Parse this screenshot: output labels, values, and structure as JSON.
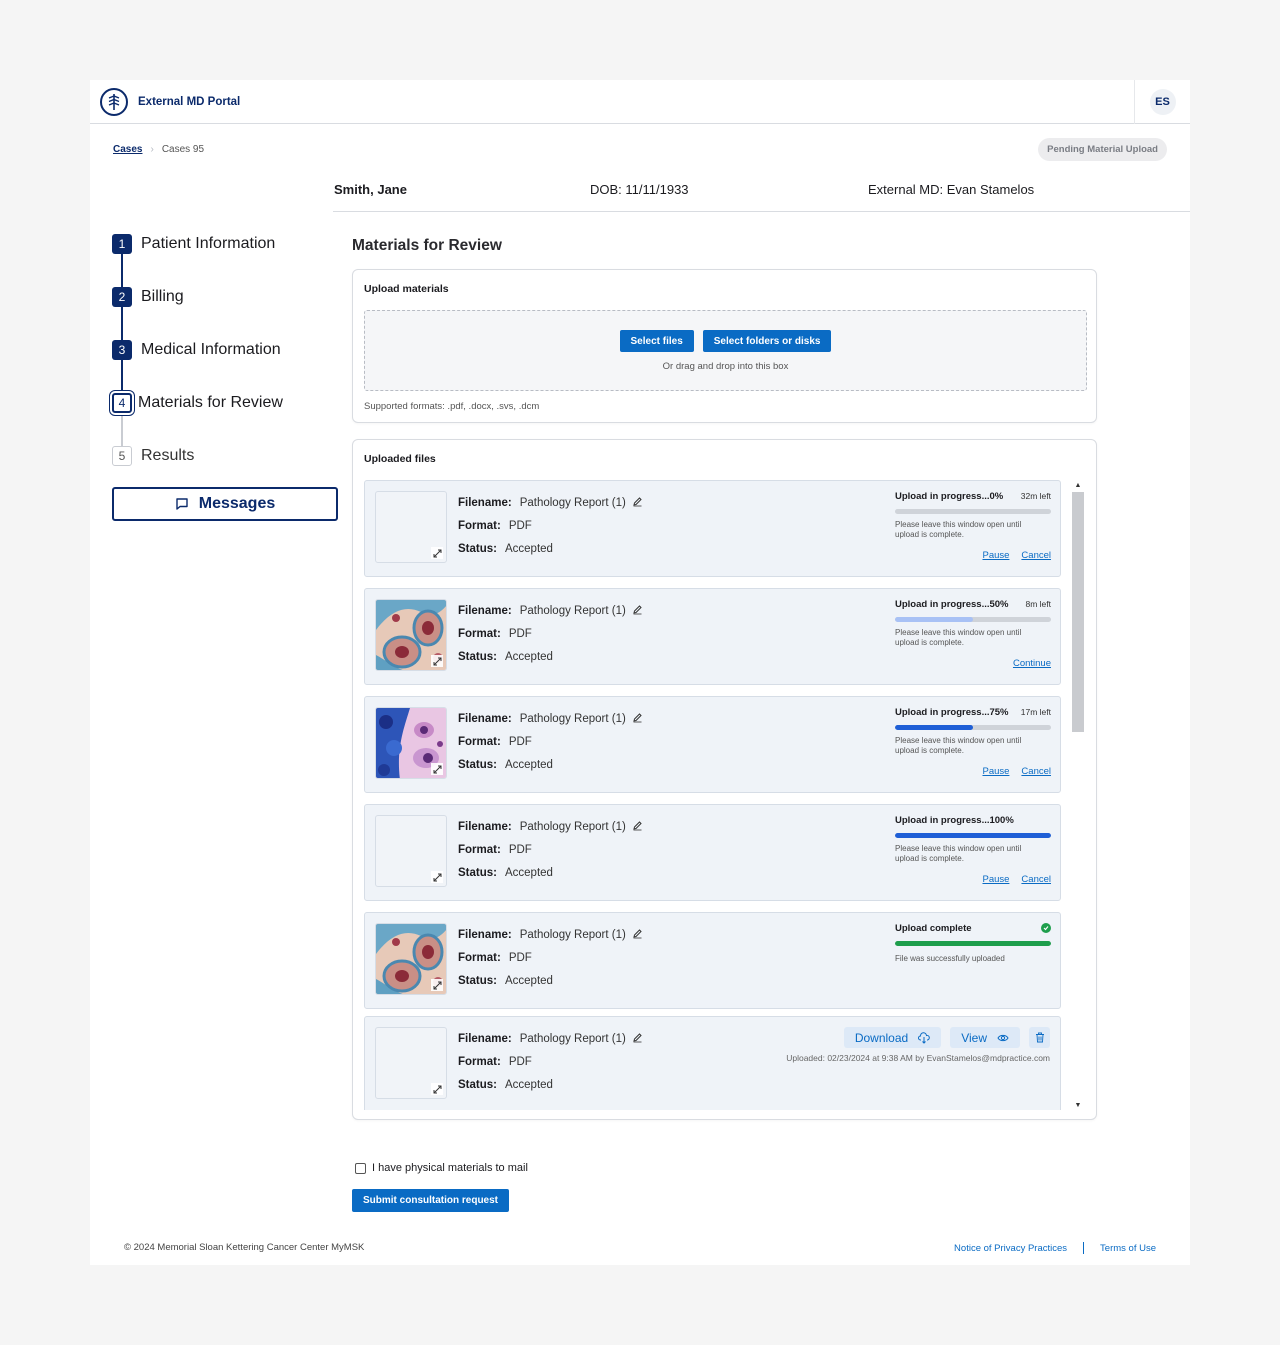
{
  "header": {
    "portal_title": "External MD Portal",
    "avatar_initials": "ES"
  },
  "breadcrumb": {
    "root": "Cases",
    "current": "Cases 95"
  },
  "case_status": "Pending Material Upload",
  "patient": {
    "name": "Smith, Jane",
    "dob": "DOB: 11/11/1933",
    "external_md": "External MD: Evan Stamelos"
  },
  "steps": [
    {
      "num": "1",
      "label": "Patient Information",
      "state": "done"
    },
    {
      "num": "2",
      "label": "Billing",
      "state": "done"
    },
    {
      "num": "3",
      "label": "Medical Information",
      "state": "done"
    },
    {
      "num": "4",
      "label": "Materials for Review",
      "state": "active"
    },
    {
      "num": "5",
      "label": "Results",
      "state": "pending"
    }
  ],
  "messages_label": "Messages",
  "main": {
    "title": "Materials for Review",
    "upload": {
      "title": "Upload materials",
      "select_files": "Select files",
      "select_folders": "Select folders or disks",
      "drag_hint": "Or drag and drop into this box",
      "formats": "Supported formats: .pdf, .docx, .svs, .dcm"
    },
    "uploaded": {
      "title": "Uploaded files",
      "labels": {
        "filename": "Filename:",
        "format": "Format:",
        "status": "Status:"
      },
      "note": "Please leave this window open until upload is complete.",
      "files": [
        {
          "filename": "Pathology Report (1)",
          "format": "PDF",
          "status": "Accepted",
          "thumb": "none",
          "progress_title": "Upload in progress...0%",
          "remaining": "32m left",
          "progress": 0,
          "bar_color": "#cfd3d9",
          "actions": [
            "Pause",
            "Cancel"
          ]
        },
        {
          "filename": "Pathology Report (1)",
          "format": "PDF",
          "status": "Accepted",
          "thumb": "tissue-pink",
          "progress_title": "Upload in progress...50%",
          "remaining": "8m left",
          "progress": 0.5,
          "bar_color": "#a8c1f5",
          "actions": [
            "Continue"
          ]
        },
        {
          "filename": "Pathology Report (1)",
          "format": "PDF",
          "status": "Accepted",
          "thumb": "tissue-blue",
          "progress_title": "Upload in progress...75%",
          "remaining": "17m left",
          "progress": 0.5,
          "bar_color": "#1f5fd6",
          "actions": [
            "Pause",
            "Cancel"
          ]
        },
        {
          "filename": "Pathology Report (1)",
          "format": "PDF",
          "status": "Accepted",
          "thumb": "none",
          "progress_title": "Upload in progress...100%",
          "remaining": "",
          "progress": 1.0,
          "bar_color": "#1f5fd6",
          "actions": [
            "Pause",
            "Cancel"
          ]
        },
        {
          "filename": "Pathology Report (1)",
          "format": "PDF",
          "status": "Accepted",
          "thumb": "tissue-pink",
          "progress_title": "Upload complete",
          "complete_note": "File was successfully uploaded",
          "progress": 1.0,
          "bar_color": "#1e9e4c",
          "complete": true
        },
        {
          "filename": "Pathology Report (1)",
          "format": "PDF",
          "status": "Accepted",
          "thumb": "none",
          "download": "Download",
          "view": "View",
          "uploaded_by": "Uploaded: 02/23/2024 at 9:38 AM by EvanStamelos@mdpractice.com",
          "finished": true
        }
      ]
    },
    "mail_label": "I have physical materials to mail",
    "submit_label": "Submit consultation request"
  },
  "footer": {
    "copyright": "© 2024 Memorial Sloan Kettering Cancer Center MyMSK",
    "privacy": "Notice of Privacy Practices",
    "terms": "Terms of Use"
  },
  "colors": {
    "brand_navy": "#0b2a6b",
    "primary_blue": "#0a6bc4",
    "success_green": "#1e9e4c"
  }
}
